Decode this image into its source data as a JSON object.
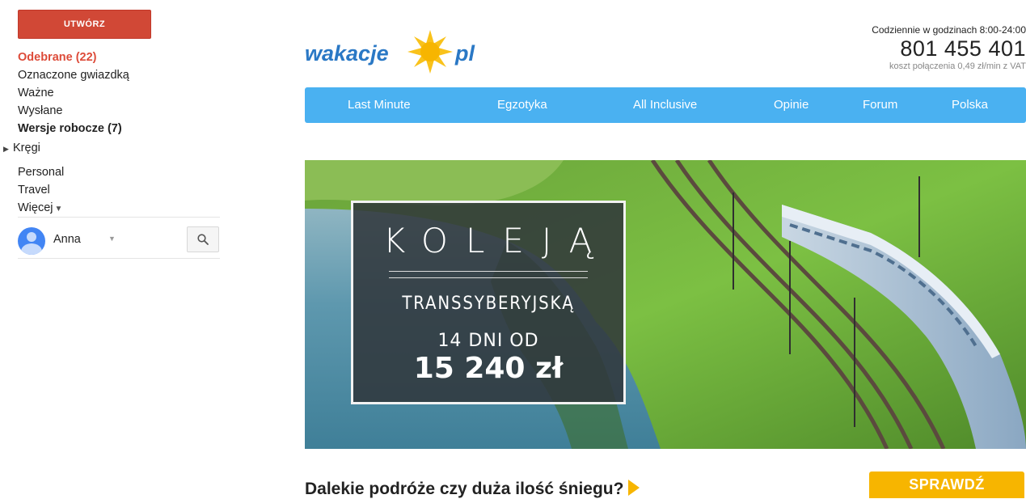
{
  "sidebar": {
    "compose_label": "UTWÓRZ",
    "folders": [
      {
        "label": "Odebrane (22)"
      },
      {
        "label": "Oznaczone gwiazdką"
      },
      {
        "label": "Ważne"
      },
      {
        "label": "Wysłane"
      },
      {
        "label": "Wersje robocze (7)"
      }
    ],
    "circles_label": "Kręgi",
    "labels": [
      {
        "label": "Personal"
      },
      {
        "label": "Travel"
      },
      {
        "label": "Więcej"
      }
    ],
    "user_name": "Anna",
    "accent_color": "#d14836"
  },
  "email": {
    "logo": {
      "left": "wakacje",
      "right": "pl"
    },
    "contact": {
      "hours": "Codziennie w godzinach 8:00-24:00",
      "phone": "801 455 401",
      "cost": "koszt połączenia 0,49 zł/min z VAT"
    },
    "menu": [
      {
        "label": "Last Minute"
      },
      {
        "label": "Egzotyka"
      },
      {
        "label": "All Inclusive"
      },
      {
        "label": "Opinie"
      },
      {
        "label": "Forum"
      },
      {
        "label": "Polska"
      }
    ],
    "banner": {
      "title": "KOLEJĄ",
      "subtitle": "TRANSSYBERYJSKĄ",
      "days": "14 DNI OD",
      "price": "15 240 zł"
    },
    "headline": "Dalekie podróże czy duża ilość śniegu?",
    "cta_label": "SPRAWDŹ",
    "menu_color": "#4ab1f1",
    "cta_color": "#f7b500"
  }
}
